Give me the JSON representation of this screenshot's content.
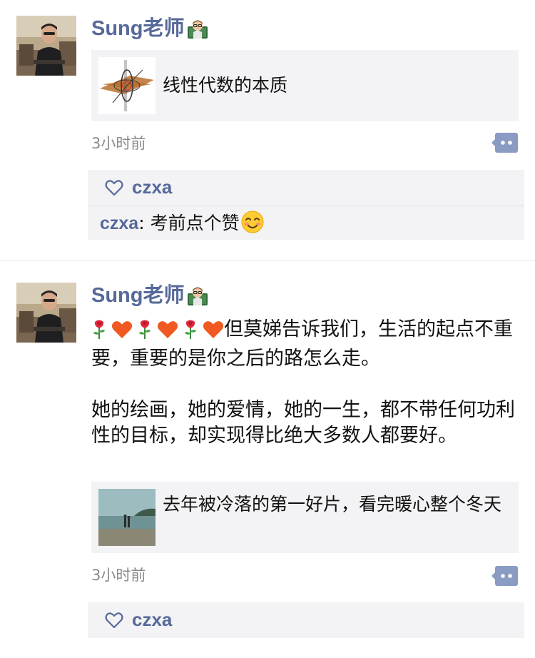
{
  "colors": {
    "name_blue": "#56699a",
    "card_bg": "#f3f3f5",
    "time_gray": "#8a8a8a",
    "heart_red": "#f05a22",
    "comment_icon": "#8a9bc4"
  },
  "icons": {
    "teacher": "man-teacher-emoji",
    "rose": "rose-emoji",
    "heart": "orange-heart-emoji",
    "like": "heart-outline-icon",
    "comment": "comment-bubble-icon",
    "smile": "smiling-face-emoji"
  },
  "posts": [
    {
      "author": "Sung老师",
      "link": {
        "title": "线性代数的本质"
      },
      "time": "3小时前",
      "likes": [
        "czxa"
      ],
      "comments": [
        {
          "author": "czxa",
          "separator": ": ",
          "text": "考前点个赞"
        }
      ]
    },
    {
      "author": "Sung老师",
      "text_paragraphs": [
        "但莫娣告诉我们，生活的起点不重要，重要的是你之后的路怎么走。",
        "她的绘画，她的爱情，她的一生，都不带任何功利性的目标，却实现得比绝大多数人都要好。"
      ],
      "link": {
        "title": "去年被冷落的第一好片，看完暖心整个冬天"
      },
      "time": "3小时前",
      "likes": [
        "czxa"
      ]
    }
  ]
}
